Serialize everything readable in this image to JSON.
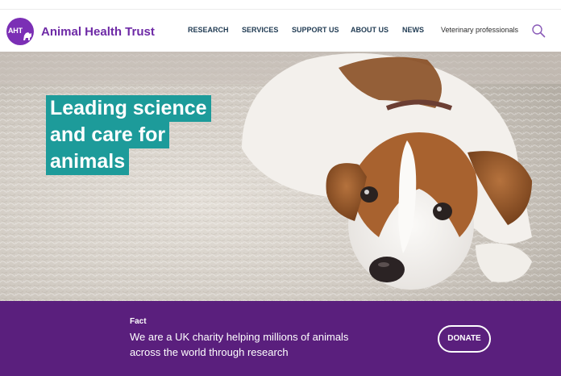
{
  "header": {
    "logo_badge": "AHT",
    "logo_name": "Animal Health Trust",
    "nav": [
      {
        "label": "RESEARCH"
      },
      {
        "label": "SERVICES"
      },
      {
        "label": "SUPPORT US"
      },
      {
        "label": "ABOUT US"
      },
      {
        "label": "NEWS"
      },
      {
        "label": "Veterinary professionals"
      }
    ],
    "search_icon": "search-icon"
  },
  "hero": {
    "headline_lines": [
      "Leading science",
      "and care for",
      "animals"
    ],
    "image": "puppy-on-rug-photo"
  },
  "fact": {
    "label": "Fact",
    "text": "We are a UK charity helping millions of animals across the world through research",
    "donate_label": "DONATE"
  },
  "colors": {
    "brand_purple": "#6e2aa6",
    "fact_bar": "#5a1f7d",
    "headline_teal": "#1d9b9a",
    "nav_text": "#1f3a52"
  }
}
